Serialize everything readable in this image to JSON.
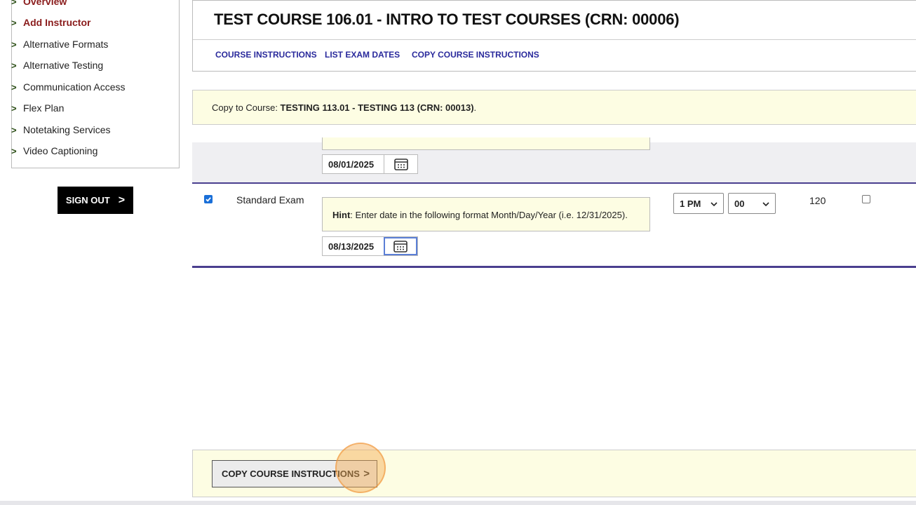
{
  "sidebar": {
    "items": [
      {
        "label": "Overview",
        "active": true
      },
      {
        "label": "Add Instructor",
        "active": true
      },
      {
        "label": "Alternative Formats"
      },
      {
        "label": "Alternative Testing"
      },
      {
        "label": "Communication Access"
      },
      {
        "label": "Flex Plan"
      },
      {
        "label": "Notetaking Services"
      },
      {
        "label": "Video Captioning"
      }
    ],
    "sign_out_label": "SIGN OUT",
    "sign_out_icon": "chevron-right-icon"
  },
  "header": {
    "title": "TEST COURSE 106.01 - INTRO TO TEST COURSES (CRN: 00006)",
    "tabs": [
      "COURSE INSTRUCTIONS",
      "LIST EXAM DATES",
      "COPY COURSE INSTRUCTIONS"
    ]
  },
  "banner": {
    "prefix": "Copy to Course: ",
    "course": "TESTING 113.01 - TESTING 113 (CRN: 00013)",
    "suffix": "."
  },
  "rows": [
    {
      "date": "08/01/2025"
    },
    {
      "checked": true,
      "exam_type": "Standard Exam",
      "hint_label": "Hint",
      "hint_text": ": Enter date in the following format Month/Day/Year (i.e. 12/31/2025).",
      "date": "08/13/2025",
      "hour": "1 PM",
      "minute": "00",
      "duration": "120",
      "extra_checked": false
    }
  ],
  "action": {
    "button_label": "COPY COURSE INSTRUCTIONS",
    "button_icon": "chevron-right-icon"
  },
  "colors": {
    "link": "#2a2a9c",
    "active_nav": "#8a1c1c",
    "banner_bg": "#fdfde3",
    "rule": "#4a3f8f",
    "checkbox": "#1a6fd8"
  }
}
